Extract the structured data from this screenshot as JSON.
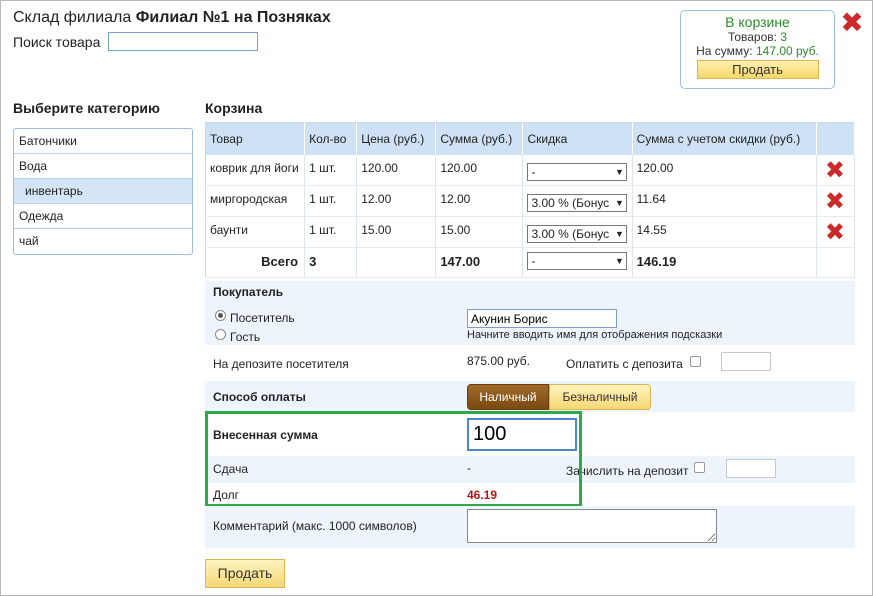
{
  "header": {
    "title_prefix": "Склад филиала",
    "title_branch": "Филиал №1 на Позняках",
    "search_label": "Поиск товара",
    "search_value": ""
  },
  "cart_summary": {
    "title": "В корзине",
    "items_label": "Товаров:",
    "items_count": "3",
    "sum_label": "На сумму:",
    "sum_value": "147.00 руб.",
    "sell_label": "Продать"
  },
  "categories": {
    "title": "Выберите категорию",
    "items": [
      "Батончики",
      "Вода",
      "инвентарь",
      "Одежда",
      "чай"
    ],
    "active": "инвентарь"
  },
  "cart": {
    "title": "Корзина",
    "columns": [
      "Товар",
      "Кол-во",
      "Цена (руб.)",
      "Сумма (руб.)",
      "Скидка",
      "Сумма с учетом скидки (руб.)",
      ""
    ],
    "rows": [
      {
        "name": "коврик для йоги",
        "qty": "1 шт.",
        "price": "120.00",
        "sum": "120.00",
        "discount": "-",
        "total": "120.00"
      },
      {
        "name": "миргородская",
        "qty": "1 шт.",
        "price": "12.00",
        "sum": "12.00",
        "discount": "3.00 % (Бонус",
        "total": "11.64"
      },
      {
        "name": "баунти",
        "qty": "1 шт.",
        "price": "15.00",
        "sum": "15.00",
        "discount": "3.00 % (Бонус",
        "total": "14.55"
      }
    ],
    "total": {
      "label": "Всего",
      "qty": "3",
      "sum": "147.00",
      "discount": "-",
      "total": "146.19"
    }
  },
  "buyer": {
    "title": "Покупатель",
    "option_visitor": "Посетитель",
    "option_guest": "Гость",
    "name_value": "Акунин Борис",
    "hint": "Начните вводить имя для отображения подсказки",
    "deposit_label": "На депозите посетителя",
    "deposit_value": "875.00 руб.",
    "pay_from_deposit": "Оплатить с депозита"
  },
  "payment": {
    "title": "Способ оплаты",
    "cash": "Наличный",
    "card": "Безналичный",
    "paid_label": "Внесенная сумма",
    "paid_value": "100",
    "change_label": "Сдача",
    "change_value": "-",
    "credit_to_deposit": "Зачислить на депозит",
    "debt_label": "Долг",
    "debt_value": "46.19",
    "comment_label": "Комментарий (макс. 1000 символов)",
    "comment_value": "",
    "sell_label": "Продать"
  },
  "colors": {
    "accent_blue": "#cfe2f5",
    "delete_red": "#cc2a2a",
    "debt_red": "#b01818",
    "highlight_green": "#2ea84a"
  }
}
